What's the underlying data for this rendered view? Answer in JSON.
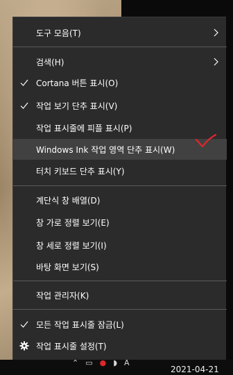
{
  "menu": {
    "items": [
      {
        "label": "도구 모음(T)",
        "submenu": true
      },
      {
        "label": "검색(H)",
        "submenu": true
      },
      {
        "label": "Cortana 버튼 표시(O)",
        "checked": true
      },
      {
        "label": "작업 보기 단추 표시(V)",
        "checked": true
      },
      {
        "label": "작업 표시줄에 피플 표시(P)"
      },
      {
        "label": "Windows Ink 작업 영역 단추 표시(W)",
        "highlighted": true
      },
      {
        "label": "터치 키보드 단추 표시(Y)"
      },
      {
        "label": "계단식 창 배열(D)"
      },
      {
        "label": "창 가로 정렬 보기(E)"
      },
      {
        "label": "창 세로 정렬 보기(I)"
      },
      {
        "label": "바탕 화면 보기(S)"
      },
      {
        "label": "작업 관리자(K)"
      },
      {
        "label": "모든 작업 표시줄 잠금(L)",
        "checked": true
      },
      {
        "label": "작업 표시줄 설정(T)",
        "icon": "gear-icon"
      }
    ]
  },
  "taskbar": {
    "date": "2021-04-21",
    "tray_letter": "A"
  },
  "colors": {
    "menu_bg": "#2b2b2b",
    "highlight_bg": "#414141",
    "separator": "#5a5a5a",
    "annotation_red": "#e0262b"
  }
}
